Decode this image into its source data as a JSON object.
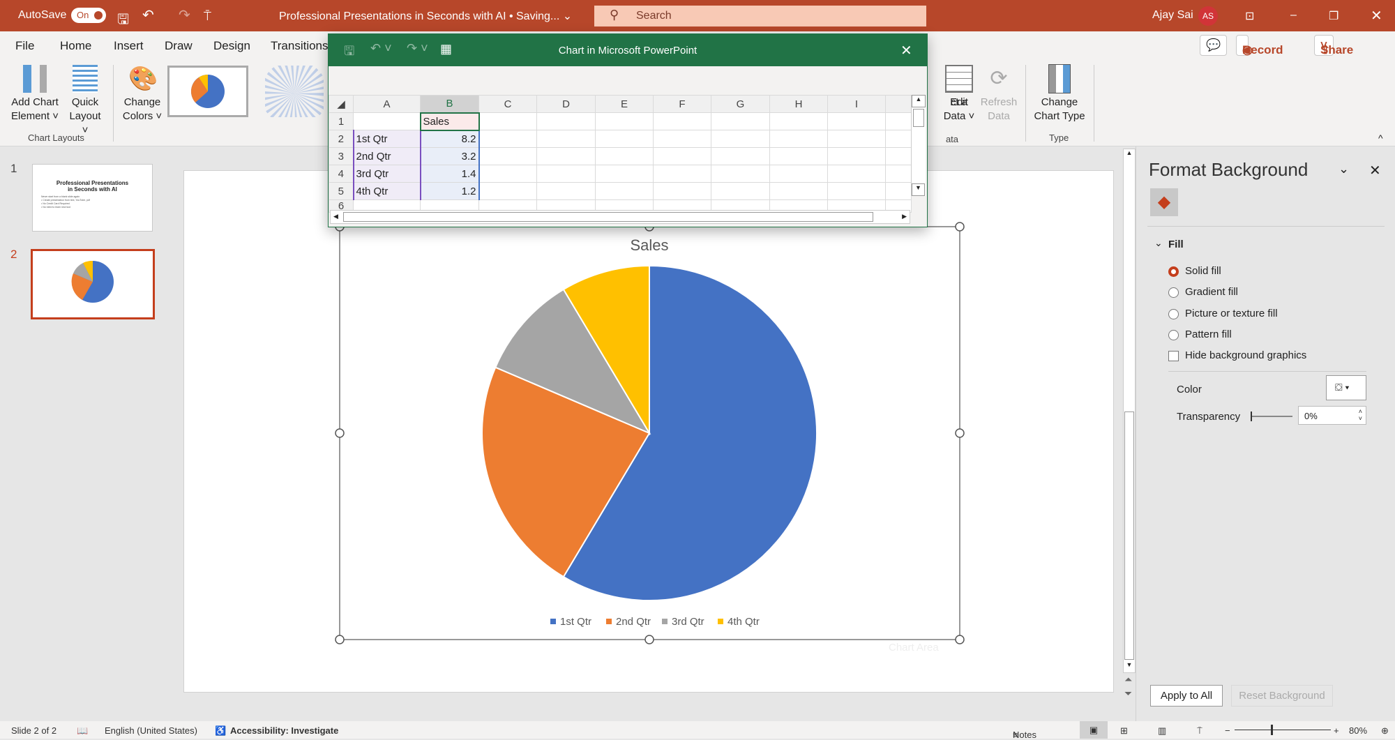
{
  "titlebar": {
    "autosave": "AutoSave",
    "autosave_state": "On",
    "doc_title": "Professional Presentations in Seconds with AI • Saving... ⌄",
    "search_placeholder": "Search",
    "user": "Ajay Sai",
    "initials": "AS"
  },
  "tabs": [
    "File",
    "Home",
    "Insert",
    "Draw",
    "Design",
    "Transitions"
  ],
  "ribbon": {
    "add_chart_element": "Add Chart Element ˅",
    "quick_layout": "Quick Layout ˅",
    "change_colors": "Change Colors ˅",
    "group_chart_layouts": "Chart Layouts",
    "select_data_partial": "ct a",
    "edit_data": "Edit Data ˅",
    "refresh_data": "Refresh Data",
    "change_chart_type": "Change Chart Type",
    "group_data_partial": "ata",
    "group_type": "Type",
    "comment": "💬",
    "record": "Record",
    "share": "Share"
  },
  "excel": {
    "title": "Chart in Microsoft PowerPoint",
    "columns": [
      "A",
      "B",
      "C",
      "D",
      "E",
      "F",
      "G",
      "H",
      "I"
    ],
    "rows": [
      {
        "n": "1",
        "a": "",
        "b": "Sales"
      },
      {
        "n": "2",
        "a": "1st Qtr",
        "b": "8.2"
      },
      {
        "n": "3",
        "a": "2nd Qtr",
        "b": "3.2"
      },
      {
        "n": "4",
        "a": "3rd Qtr",
        "b": "1.4"
      },
      {
        "n": "5",
        "a": "4th Qtr",
        "b": "1.2"
      },
      {
        "n": "6",
        "a": "",
        "b": ""
      }
    ]
  },
  "thumbnails": [
    {
      "num": "1",
      "title": "Professional Presentations in Seconds with AI",
      "lines": [
        "Never start from a blank slide again",
        "• Create presentation from text, YouTube, pdf",
        "• No Credit Card Required",
        "• No need to learn new tool"
      ]
    },
    {
      "num": "2"
    }
  ],
  "chart_data": {
    "type": "pie",
    "title": "Sales",
    "categories": [
      "1st Qtr",
      "2nd Qtr",
      "3rd Qtr",
      "4th Qtr"
    ],
    "values": [
      8.2,
      3.2,
      1.4,
      1.2
    ],
    "colors": [
      "#4472c4",
      "#ed7d31",
      "#a5a5a5",
      "#ffc000"
    ],
    "legend": "bottom",
    "tooltip": "Chart Area"
  },
  "pane": {
    "title": "Format Background",
    "section": "Fill",
    "options": [
      "Solid fill",
      "Gradient fill",
      "Picture or texture fill",
      "Pattern fill"
    ],
    "selected": "Solid fill",
    "hide_bg": "Hide background graphics",
    "color_label": "Color",
    "transparency_label": "Transparency",
    "transparency_value": "0%",
    "apply_all": "Apply to All",
    "reset": "Reset Background"
  },
  "status": {
    "slide": "Slide 2 of 2",
    "language": "English (United States)",
    "accessibility": "Accessibility: Investigate",
    "notes": "Notes",
    "zoom": "80%"
  }
}
